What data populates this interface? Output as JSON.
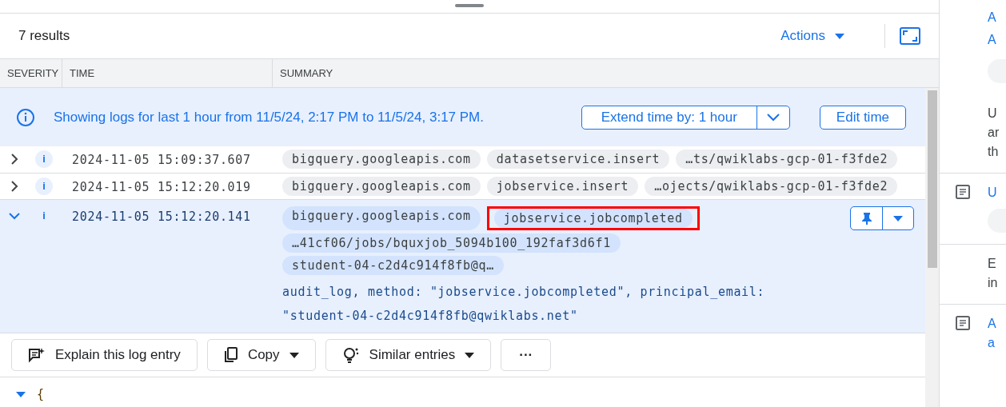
{
  "results_count": "7 results",
  "actions_button": "Actions",
  "columns": [
    "SEVERITY",
    "TIME",
    "SUMMARY"
  ],
  "banner": {
    "text": "Showing logs for last 1 hour from 11/5/24, 2:17 PM to 11/5/24, 3:17 PM.",
    "extend_button": "Extend time by: 1 hour",
    "edit_button": "Edit time"
  },
  "rows": [
    {
      "expanded": false,
      "severity": "i",
      "time": "2024-11-05 15:09:37.607",
      "chips": [
        {
          "text": "bigquery.googleapis.com",
          "highlighted": false
        },
        {
          "text": "datasetservice.insert",
          "highlighted": false
        },
        {
          "text": "…ts/qwiklabs-gcp-01-f3fde2",
          "highlighted": false
        }
      ]
    },
    {
      "expanded": false,
      "severity": "i",
      "time": "2024-11-05 15:12:20.019",
      "chips": [
        {
          "text": "bigquery.googleapis.com",
          "highlighted": false
        },
        {
          "text": "jobservice.insert",
          "highlighted": false
        },
        {
          "text": "…ojects/qwiklabs-gcp-01-f3fde2",
          "highlighted": false
        }
      ]
    },
    {
      "expanded": true,
      "severity": "i",
      "time": "2024-11-05 15:12:20.141",
      "chips": [
        {
          "text": "bigquery.googleapis.com",
          "highlighted": false
        },
        {
          "text": "jobservice.jobcompleted",
          "highlighted": true
        },
        {
          "text": "…41cf06/jobs/bquxjob_5094b100_192faf3d6f1",
          "highlighted": false
        },
        {
          "text": "student-04-c2d4c914f8fb@q…",
          "highlighted": false
        }
      ],
      "summary": "audit_log, method: \"jobservice.jobcompleted\", principal_email: \"student-04-c2d4c914f8fb@qwiklabs.net\""
    }
  ],
  "entry_actions": [
    {
      "kind": "explain",
      "label": "Explain this log entry"
    },
    {
      "kind": "copy",
      "label": "Copy"
    },
    {
      "kind": "similar",
      "label": "Similar entries"
    },
    {
      "kind": "more",
      "label": "···"
    }
  ],
  "json_open_brace": "{",
  "side_panel": [
    {
      "kind": "link",
      "texts": [
        "A",
        "A"
      ]
    },
    {
      "kind": "text",
      "texts": [
        "U",
        "ar",
        "th"
      ]
    },
    {
      "kind": "doc-link",
      "texts": [
        "U"
      ]
    },
    {
      "kind": "text",
      "texts": [
        "E",
        "in"
      ]
    },
    {
      "kind": "doc-link",
      "texts": [
        "A",
        "a"
      ]
    }
  ]
}
